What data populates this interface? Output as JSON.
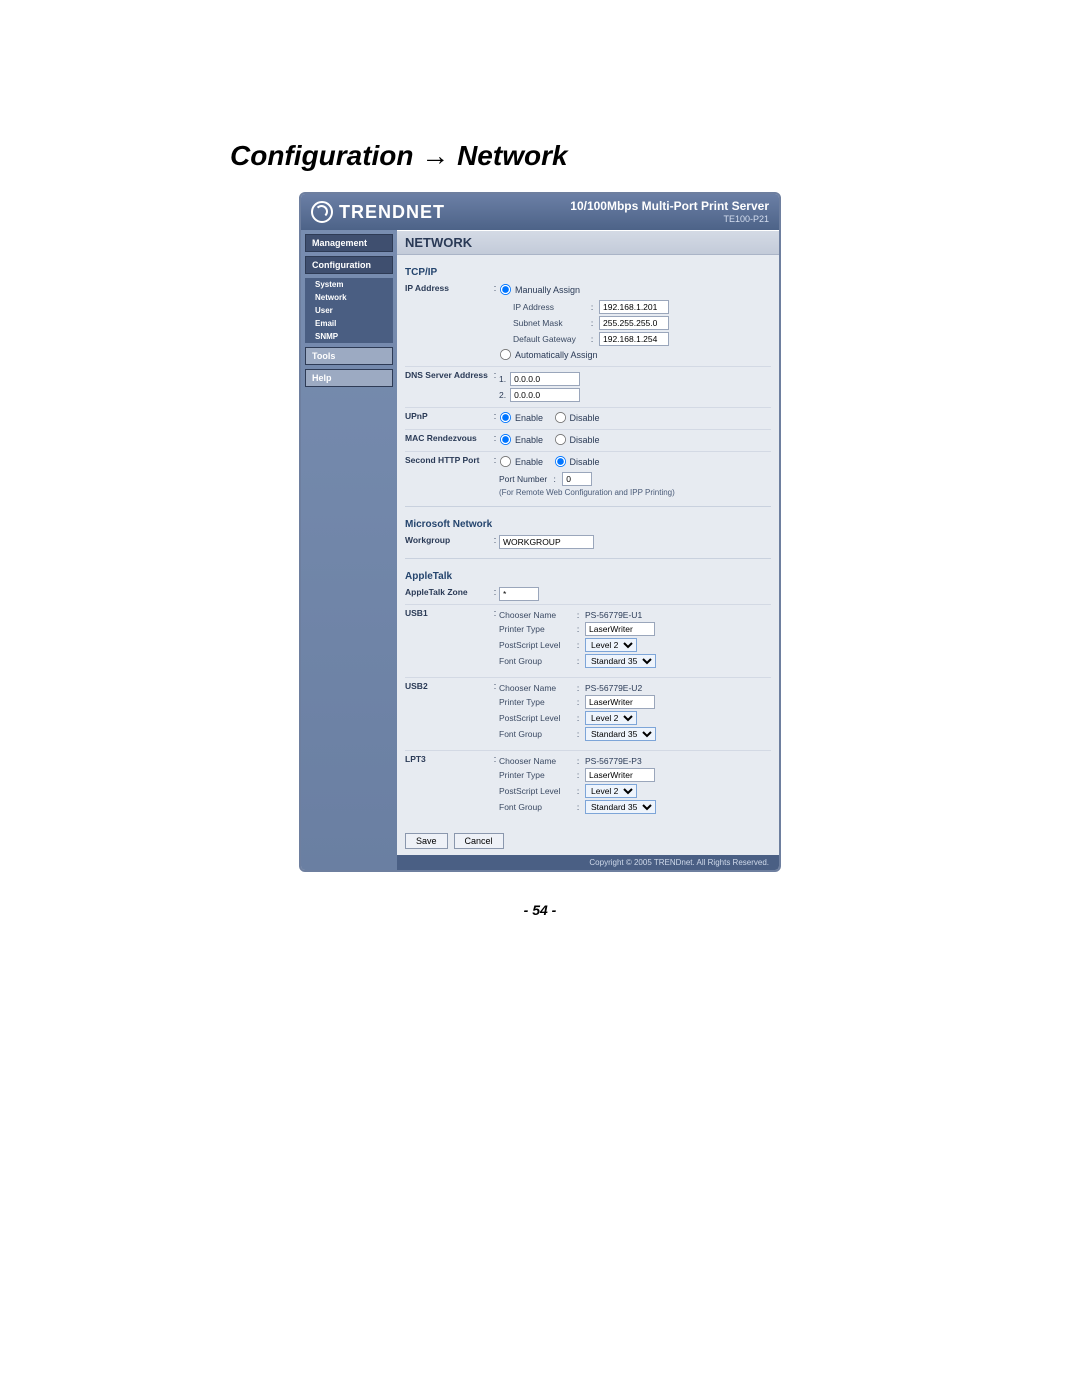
{
  "doc": {
    "heading": "Configuration → Network",
    "page_number": "- 54 -"
  },
  "header": {
    "brand": "TRENDNET",
    "title": "10/100Mbps Multi-Port Print Server",
    "model": "TE100-P21"
  },
  "nav": {
    "management": "Management",
    "configuration": "Configuration",
    "sub": {
      "system": "System",
      "network": "Network",
      "user": "User",
      "email": "Email",
      "snmp": "SNMP"
    },
    "tools": "Tools",
    "help": "Help"
  },
  "page_title": "NETWORK",
  "sections": {
    "tcpip": {
      "title": "TCP/IP",
      "ip_address_label": "IP Address",
      "manually": "Manually Assign",
      "auto": "Automatically Assign",
      "ip_label": "IP Address",
      "ip_value": "192.168.1.201",
      "subnet_label": "Subnet Mask",
      "subnet_value": "255.255.255.0",
      "gw_label": "Default Gateway",
      "gw_value": "192.168.1.254",
      "dns_label": "DNS Server Address",
      "dns1_label": "1.",
      "dns1_value": "0.0.0.0",
      "dns2_label": "2.",
      "dns2_value": "0.0.0.0",
      "upnp_label": "UPnP",
      "mac_label": "MAC Rendezvous",
      "http_label": "Second HTTP Port",
      "enable": "Enable",
      "disable": "Disable",
      "port_number_label": "Port Number",
      "port_number_value": "0",
      "port_note": "(For Remote Web Configuration and IPP Printing)"
    },
    "msnet": {
      "title": "Microsoft Network",
      "workgroup_label": "Workgroup",
      "workgroup_value": "WORKGROUP"
    },
    "apple": {
      "title": "AppleTalk",
      "zone_label": "AppleTalk Zone",
      "zone_value": "*",
      "chooser_label": "Chooser Name",
      "printer_type_label": "Printer Type",
      "ps_level_label": "PostScript Level",
      "font_group_label": "Font Group",
      "printer_type_value": "LaserWriter",
      "ps_level_value": "Level 2",
      "font_group_value": "Standard 35",
      "ports": {
        "usb1": {
          "label": "USB1",
          "chooser": "PS-56779E-U1"
        },
        "usb2": {
          "label": "USB2",
          "chooser": "PS-56779E-U2"
        },
        "lpt3": {
          "label": "LPT3",
          "chooser": "PS-56779E-P3"
        }
      }
    }
  },
  "buttons": {
    "save": "Save",
    "cancel": "Cancel"
  },
  "footer": "Copyright © 2005 TRENDnet. All Rights Reserved."
}
